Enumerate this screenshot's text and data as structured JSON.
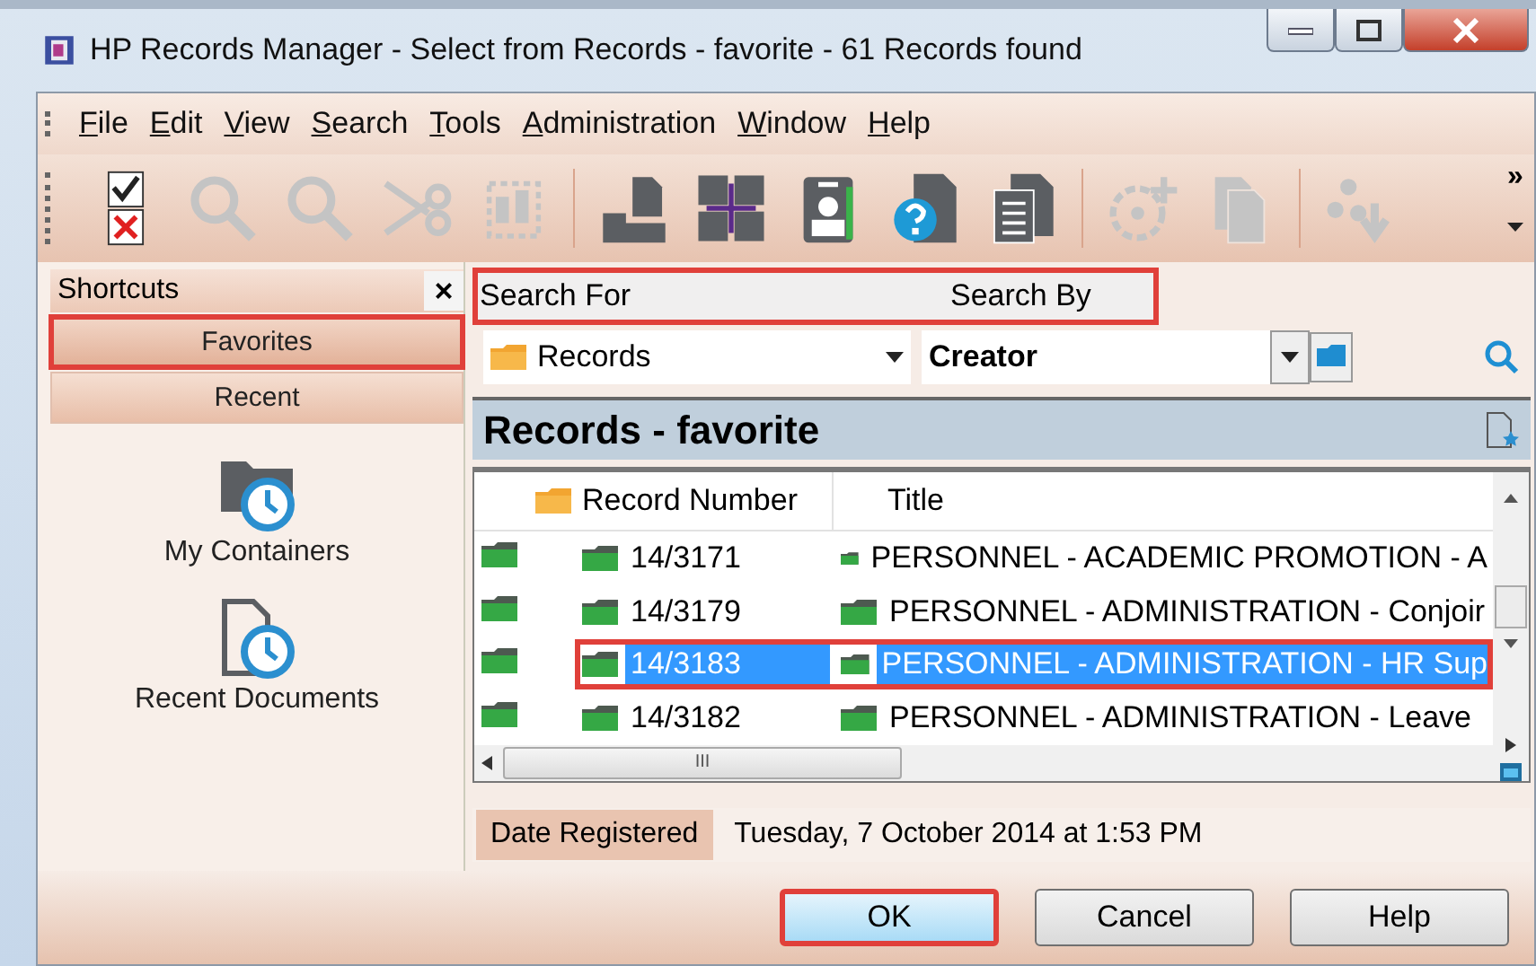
{
  "window": {
    "title": "HP Records Manager - Select from Records - favorite - 61 Records found"
  },
  "menu": [
    {
      "label": "File"
    },
    {
      "label": "Edit"
    },
    {
      "label": "View"
    },
    {
      "label": "Search"
    },
    {
      "label": "Tools"
    },
    {
      "label": "Administration"
    },
    {
      "label": "Window"
    },
    {
      "label": "Help"
    }
  ],
  "toolbar": [
    {
      "kind": "checkcross",
      "disabled": false
    },
    {
      "kind": "search",
      "disabled": true
    },
    {
      "kind": "search",
      "disabled": true
    },
    {
      "kind": "scissors",
      "disabled": true
    },
    {
      "kind": "textbox",
      "disabled": true
    },
    {
      "kind": "separator"
    },
    {
      "kind": "tray",
      "disabled": false
    },
    {
      "kind": "grid",
      "disabled": false
    },
    {
      "kind": "badge",
      "disabled": false
    },
    {
      "kind": "helpdoc",
      "disabled": false
    },
    {
      "kind": "listdoc",
      "disabled": false
    },
    {
      "kind": "separator"
    },
    {
      "kind": "gearplus",
      "disabled": true
    },
    {
      "kind": "copy",
      "disabled": true
    },
    {
      "kind": "separator"
    },
    {
      "kind": "dots",
      "disabled": true
    }
  ],
  "toolbar_overflow": "»",
  "shortcuts": {
    "title": "Shortcuts",
    "close": "×",
    "tabs": [
      {
        "label": "Favorites",
        "selected": true,
        "highlighted": true
      },
      {
        "label": "Recent",
        "selected": false,
        "highlighted": false
      }
    ],
    "items": [
      {
        "kind": "containers",
        "label": "My Containers"
      },
      {
        "kind": "documents",
        "label": "Recent Documents"
      }
    ]
  },
  "search": {
    "highlighted": true,
    "search_for_label": "Search For",
    "search_by_label": "Search By",
    "search_for": "Records",
    "search_by": "Creator"
  },
  "results": {
    "title": "Records - favorite",
    "columns": [
      "Record Number",
      "Title"
    ],
    "rows": [
      {
        "number": "14/3171",
        "title": "PERSONNEL - ACADEMIC PROMOTION - A",
        "selected": false,
        "highlighted": false
      },
      {
        "number": "14/3179",
        "title": "PERSONNEL - ADMINISTRATION - Conjoir",
        "selected": false,
        "highlighted": false
      },
      {
        "number": "14/3183",
        "title": "PERSONNEL - ADMINISTRATION - HR Sup",
        "selected": true,
        "highlighted": true
      },
      {
        "number": "14/3182",
        "title": "PERSONNEL - ADMINISTRATION - Leave",
        "selected": false,
        "highlighted": false
      }
    ],
    "scroll_grip": "III"
  },
  "detail": {
    "label": "Date Registered",
    "value": "Tuesday, 7 October 2014 at 1:53 PM"
  },
  "buttons": [
    {
      "label": "OK",
      "default": true,
      "highlighted": true
    },
    {
      "label": "Cancel",
      "default": false,
      "highlighted": false
    },
    {
      "label": "Help",
      "default": false,
      "highlighted": false
    }
  ]
}
